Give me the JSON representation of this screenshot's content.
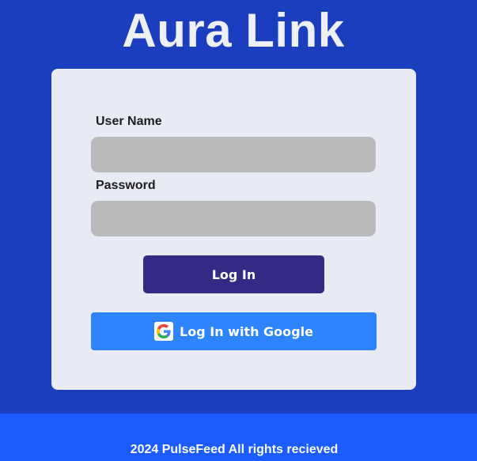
{
  "app": {
    "title": "Aura Link"
  },
  "login_form": {
    "username_label": "User Name",
    "username_value": "",
    "password_label": "Password",
    "password_value": "",
    "login_button_label": "Log In",
    "google_button_label": "Log In with Google",
    "google_icon": "google-g-logo"
  },
  "footer": {
    "text": "2024 PulseFeed All rights recieved"
  },
  "colors": {
    "background": "#1a3ebd",
    "card": "#e8eaf6",
    "input": "#b9b9b9",
    "login_button": "#332a85",
    "google_button": "#2e84ff",
    "footer": "#1a5cff"
  }
}
